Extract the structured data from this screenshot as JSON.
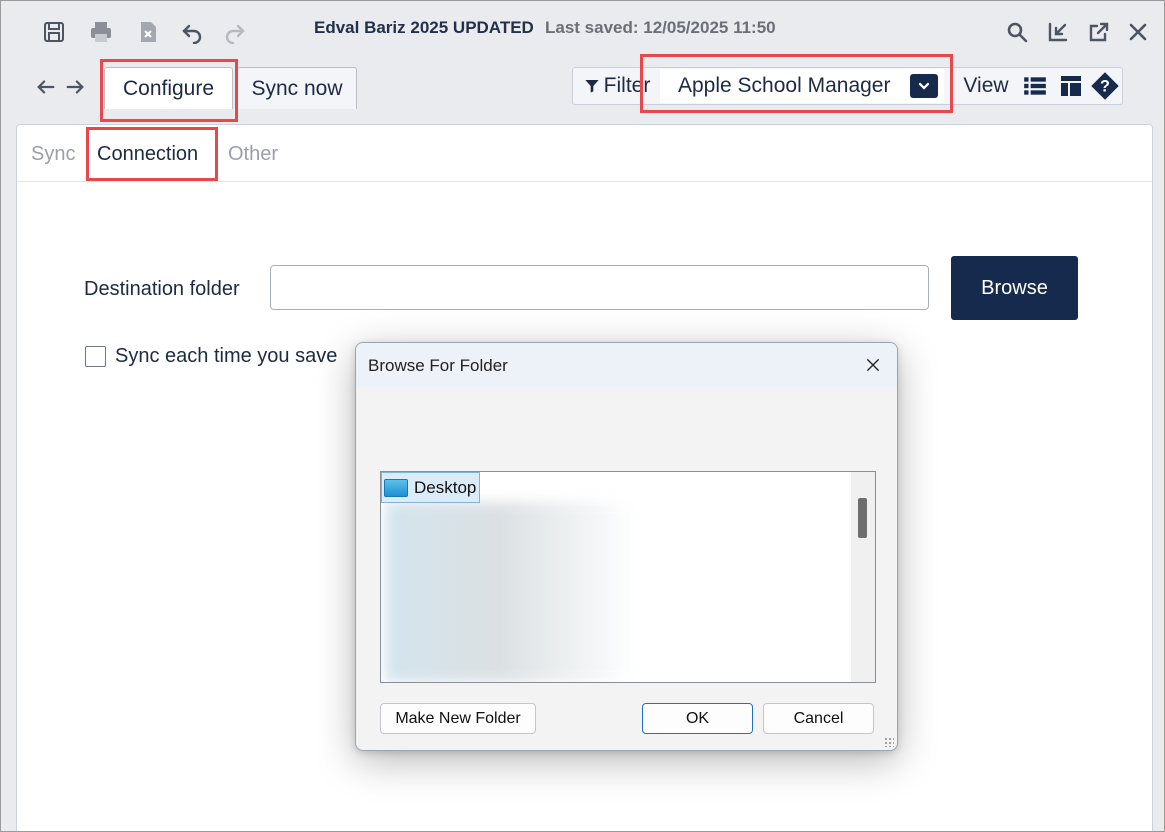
{
  "toolbar": {
    "title": "Edval Bariz 2025 UPDATED",
    "last_saved": "Last saved: 12/05/2025 11:50",
    "icons": [
      "save-icon",
      "print-icon",
      "export-icon",
      "undo-icon",
      "redo-icon",
      "search-icon",
      "minimize-icon",
      "popout-icon",
      "close-icon"
    ]
  },
  "tabs": [
    {
      "label": "Configure",
      "active": true
    },
    {
      "label": "Sync now",
      "active": false
    }
  ],
  "right_toolbar": {
    "filter_label": "Filter",
    "selected_integration": "Apple School Manager",
    "view_label": "View"
  },
  "subtabs": [
    {
      "label": "Sync",
      "active": false
    },
    {
      "label": "Connection",
      "active": true
    },
    {
      "label": "Other",
      "active": false
    }
  ],
  "connection": {
    "destination_label": "Destination folder",
    "destination_value": "",
    "browse_label": "Browse",
    "sync_checkbox_label": "Sync each time you save",
    "sync_checked": false
  },
  "dialog": {
    "title": "Browse For Folder",
    "tree_root": "Desktop",
    "make_new_folder_label": "Make New Folder",
    "ok_label": "OK",
    "cancel_label": "Cancel"
  },
  "colors": {
    "accent_navy": "#152a4d",
    "highlight_red": "#e8474c",
    "text_dark": "#1d2a44"
  }
}
